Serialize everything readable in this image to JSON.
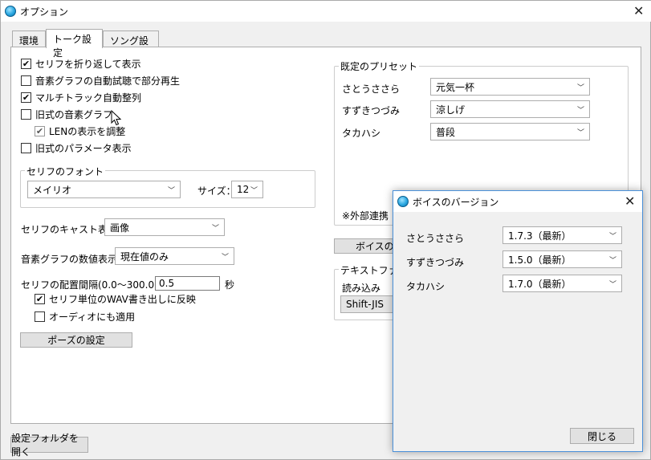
{
  "window": {
    "title": "オプション"
  },
  "tabs": [
    "環境",
    "トーク設定",
    "ソング設定"
  ],
  "talk": {
    "options": [
      {
        "label": "セリフを折り返して表示",
        "checked": true
      },
      {
        "label": "音素グラフの自動試聴で部分再生",
        "checked": false
      },
      {
        "label": "マルチトラック自動整列",
        "checked": true
      },
      {
        "label": "旧式の音素グラフ",
        "checked": false
      },
      {
        "label": "LENの表示を調整",
        "checked": true
      },
      {
        "label": "旧式のパラメータ表示",
        "checked": false
      }
    ],
    "font_group": {
      "legend": "セリフのフォント",
      "font": "メイリオ",
      "size_label": "サイズ：",
      "size": "12"
    },
    "cast_display": {
      "label": "セリフのキャスト表示",
      "value": "画像"
    },
    "graph_value": {
      "label": "音素グラフの数値表示",
      "value": "現在値のみ"
    },
    "interval": {
      "label": "セリフの配置間隔(0.0～300.0)：",
      "value": "0.5",
      "unit": "秒"
    },
    "wav_reflect": {
      "label": "セリフ単位のWAV書き出しに反映",
      "checked": true
    },
    "audio_apply": {
      "label": "オーディオにも適用",
      "checked": false
    },
    "pause_button": "ポーズの設定"
  },
  "preset": {
    "legend": "既定のプリセット",
    "rows": [
      {
        "name": "さとうささら",
        "value": "元気一杯"
      },
      {
        "name": "すずきつづみ",
        "value": "涼しげ"
      },
      {
        "name": "タカハシ",
        "value": "普段"
      }
    ],
    "note": "※外部連携"
  },
  "voice_version_button": "ボイスのバ",
  "textfile": {
    "legend": "テキストファイル",
    "read_label": "読み込み",
    "encoding": "Shift-JIS"
  },
  "footer": {
    "open_folder_button": "設定フォルダを開く"
  },
  "dialog": {
    "title": "ボイスのバージョン",
    "rows": [
      {
        "name": "さとうささら",
        "version": "1.7.3（最新）"
      },
      {
        "name": "すずきつづみ",
        "version": "1.5.0（最新）"
      },
      {
        "name": "タカハシ",
        "version": "1.7.0（最新）"
      }
    ],
    "close_button": "閉じる"
  }
}
